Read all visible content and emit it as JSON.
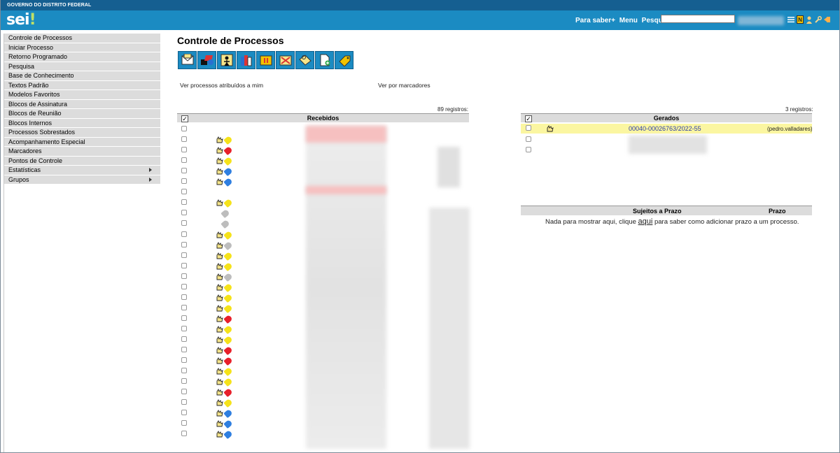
{
  "header": {
    "gov_label": "GOVERNO DO DISTRITO FEDERAL",
    "logo_text": "sei",
    "logo_dot": "!",
    "links": [
      "Para saber+",
      "Menu",
      "Pesquisa"
    ],
    "search_value": "",
    "icons": [
      "list-icon",
      "notes-icon",
      "user-icon",
      "wrench-icon",
      "exit-icon"
    ],
    "colors": {
      "gov_bar": "#155f91",
      "top_bar": "#1b8bc2"
    }
  },
  "sidebar": {
    "items": [
      {
        "label": "Controle de Processos",
        "submenu": false
      },
      {
        "label": "Iniciar Processo",
        "submenu": false
      },
      {
        "label": "Retorno Programado",
        "submenu": false
      },
      {
        "label": "Pesquisa",
        "submenu": false
      },
      {
        "label": "Base de Conhecimento",
        "submenu": false
      },
      {
        "label": "Textos Padrão",
        "submenu": false
      },
      {
        "label": "Modelos Favoritos",
        "submenu": false
      },
      {
        "label": "Blocos de Assinatura",
        "submenu": false
      },
      {
        "label": "Blocos de Reunião",
        "submenu": false
      },
      {
        "label": "Blocos Internos",
        "submenu": false
      },
      {
        "label": "Processos Sobrestados",
        "submenu": false
      },
      {
        "label": "Acompanhamento Especial",
        "submenu": false
      },
      {
        "label": "Marcadores",
        "submenu": false
      },
      {
        "label": "Pontos de Controle",
        "submenu": false
      },
      {
        "label": "Estatísticas",
        "submenu": true
      },
      {
        "label": "Grupos",
        "submenu": true
      }
    ]
  },
  "main": {
    "title": "Controle de Processos",
    "toolbar_icons": [
      "send-process-icon",
      "update-process-icon",
      "assign-process-icon",
      "print-icon",
      "sobrestar-icon",
      "conclude-process-icon",
      "annotation-icon",
      "include-document-icon",
      "marker-icon"
    ],
    "link_assigned": "Ver processos atribuídos a mim",
    "link_markers": "Ver por marcadores"
  },
  "recebidos": {
    "count_label": "89 registros:",
    "header": "Recebidos",
    "rows": [
      {
        "tags": [],
        "highlight": "pink"
      },
      {
        "tags": [
          "yellow"
        ]
      },
      {
        "tags": [
          "red"
        ]
      },
      {
        "tags": [
          "yellow"
        ]
      },
      {
        "tags": [
          "blue"
        ]
      },
      {
        "tags": [
          "blue"
        ]
      },
      {
        "tags": [],
        "highlight": "pink"
      },
      {
        "tags": [
          "yellow"
        ]
      },
      {
        "tags": [
          "gray"
        ],
        "no_hand": true
      },
      {
        "tags": [
          "gray"
        ],
        "no_hand": true
      },
      {
        "tags": [
          "yellow"
        ]
      },
      {
        "tags": [
          "gray"
        ]
      },
      {
        "tags": [
          "yellow"
        ]
      },
      {
        "tags": [
          "yellow"
        ]
      },
      {
        "tags": [
          "gray"
        ]
      },
      {
        "tags": [
          "yellow"
        ]
      },
      {
        "tags": [
          "yellow"
        ]
      },
      {
        "tags": [
          "yellow"
        ]
      },
      {
        "tags": [
          "red"
        ]
      },
      {
        "tags": [
          "yellow"
        ]
      },
      {
        "tags": [
          "yellow"
        ]
      },
      {
        "tags": [
          "red"
        ]
      },
      {
        "tags": [
          "red"
        ]
      },
      {
        "tags": [
          "yellow"
        ]
      },
      {
        "tags": [
          "yellow"
        ]
      },
      {
        "tags": [
          "red"
        ]
      },
      {
        "tags": [
          "yellow"
        ]
      },
      {
        "tags": [
          "blue"
        ]
      },
      {
        "tags": [
          "blue"
        ]
      },
      {
        "tags": [
          "blue"
        ]
      }
    ]
  },
  "gerados": {
    "count_label": "3 registros:",
    "header": "Gerados",
    "first_row": {
      "process_number": "00040-00026763/2022-55",
      "user": "(pedro.valladares)"
    }
  },
  "prazo": {
    "col_subject": "Sujeitos a Prazo",
    "col_deadline": "Prazo",
    "message_before": "Nada para mostrar aqui, clique ",
    "message_link": "aqui",
    "message_after": " para saber como adicionar prazo a um processo."
  },
  "tag_colors": {
    "yellow": "#f5e21a",
    "red": "#e8202a",
    "blue": "#2f7fe0",
    "gray": "#bdbdbd"
  }
}
